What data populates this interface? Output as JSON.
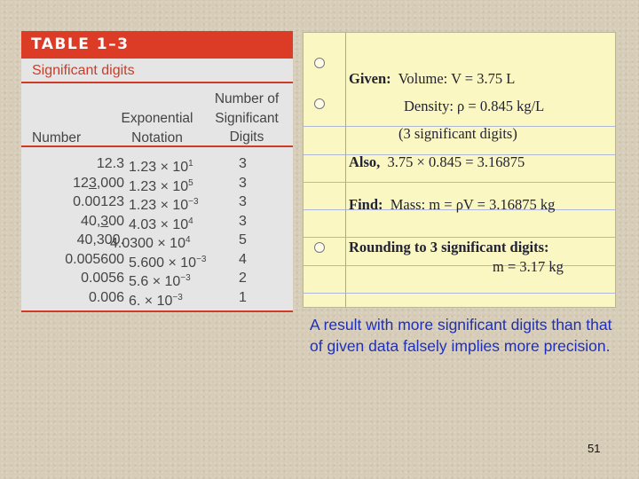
{
  "table": {
    "header": "TABLE 1–3",
    "title": "Significant digits",
    "col_number": "Number",
    "col_exp": "Exponential Notation",
    "col_sig": "Number of Significant Digits",
    "rows": [
      {
        "num": "12.3",
        "mant": "1.23 × 10",
        "exp": "1",
        "digits": "3"
      },
      {
        "num": "123,000",
        "mant": "1.23 × 10",
        "exp": "5",
        "digits": "3"
      },
      {
        "num": "0.00123",
        "mant": "1.23 × 10",
        "exp": "−3",
        "digits": "3"
      },
      {
        "num": "40,300",
        "mant": "4.03 × 10",
        "exp": "4",
        "digits": "3"
      },
      {
        "num": "40,300.",
        "mant": "4.0300 × 10",
        "exp": "4",
        "digits": "5"
      },
      {
        "num": "0.005600",
        "mant": "5.600 × 10",
        "exp": "−3",
        "digits": "4"
      },
      {
        "num": "0.0056",
        "mant": "5.6 × 10",
        "exp": "−3",
        "digits": "2"
      },
      {
        "num": "0.006",
        "mant": "6. × 10",
        "exp": "−3",
        "digits": "1"
      }
    ]
  },
  "notebook": {
    "given_label": "Given:",
    "given_text": "Volume: V = 3.75 L",
    "density_text": "Density: ρ = 0.845 kg/L",
    "sig_note": "(3 significant digits)",
    "also_label": "Also,",
    "also_text": "3.75 × 0.845 = 3.16875",
    "find_label": "Find:",
    "find_text": "Mass: m = ρV = 3.16875 kg",
    "rounding_label": "Rounding to 3 significant digits:",
    "rounding_result": "m = 3.17 kg"
  },
  "caption": "A result with more significant digits than that of given data falsely implies more precision.",
  "page_number": "51"
}
